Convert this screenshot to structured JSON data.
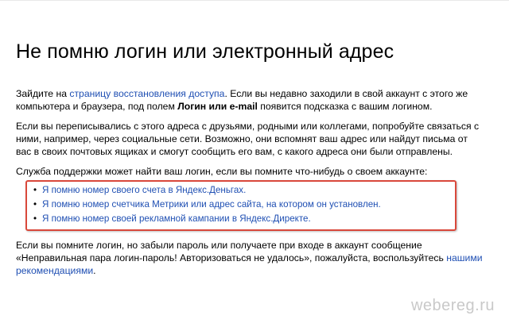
{
  "page": {
    "title": "Не помню логин или электронный адрес"
  },
  "para1": {
    "t1": "Зайдите на ",
    "link": "страницу восстановления доступа",
    "t2": ". Если вы недавно заходили в свой аккаунт с этого же компьютера и браузера, под полем ",
    "bold": "Логин или e-mail",
    "t3": " появится подсказка с вашим логином."
  },
  "para2": {
    "text": "Если вы переписывались с этого адреса с друзьями, родными или коллегами, попробуйте связаться с ними, например, через социальные сети. Возможно, они вспомнят ваш адрес или найдут письма от вас в своих почтовых ящиках и смогут сообщить его вам, с какого адреса они были отправлены."
  },
  "para3": {
    "text": "Служба поддержки может найти ваш логин, если вы помните что-нибудь о своем аккаунте:"
  },
  "support_links": [
    {
      "bullet": "•",
      "label": "Я помню номер своего счета в Яндекс.Деньгах."
    },
    {
      "bullet": "•",
      "label": "Я помню номер счетчика Метрики или адрес сайта, на котором он установлен."
    },
    {
      "bullet": "•",
      "label": "Я помню номер своей рекламной кампании в Яндекс.Директе."
    }
  ],
  "para4": {
    "t1": "Если вы помните логин, но забыли пароль или получаете при входе в аккаунт сообщение «Неправильная пара логин-пароль! Авторизоваться не удалось», пожалуйста, воспользуйтесь ",
    "link": "нашими рекомендациями",
    "t2": "."
  },
  "watermark": "webereg.ru",
  "colors": {
    "link": "#1f4fb3",
    "highlight_border": "#d9483b"
  }
}
